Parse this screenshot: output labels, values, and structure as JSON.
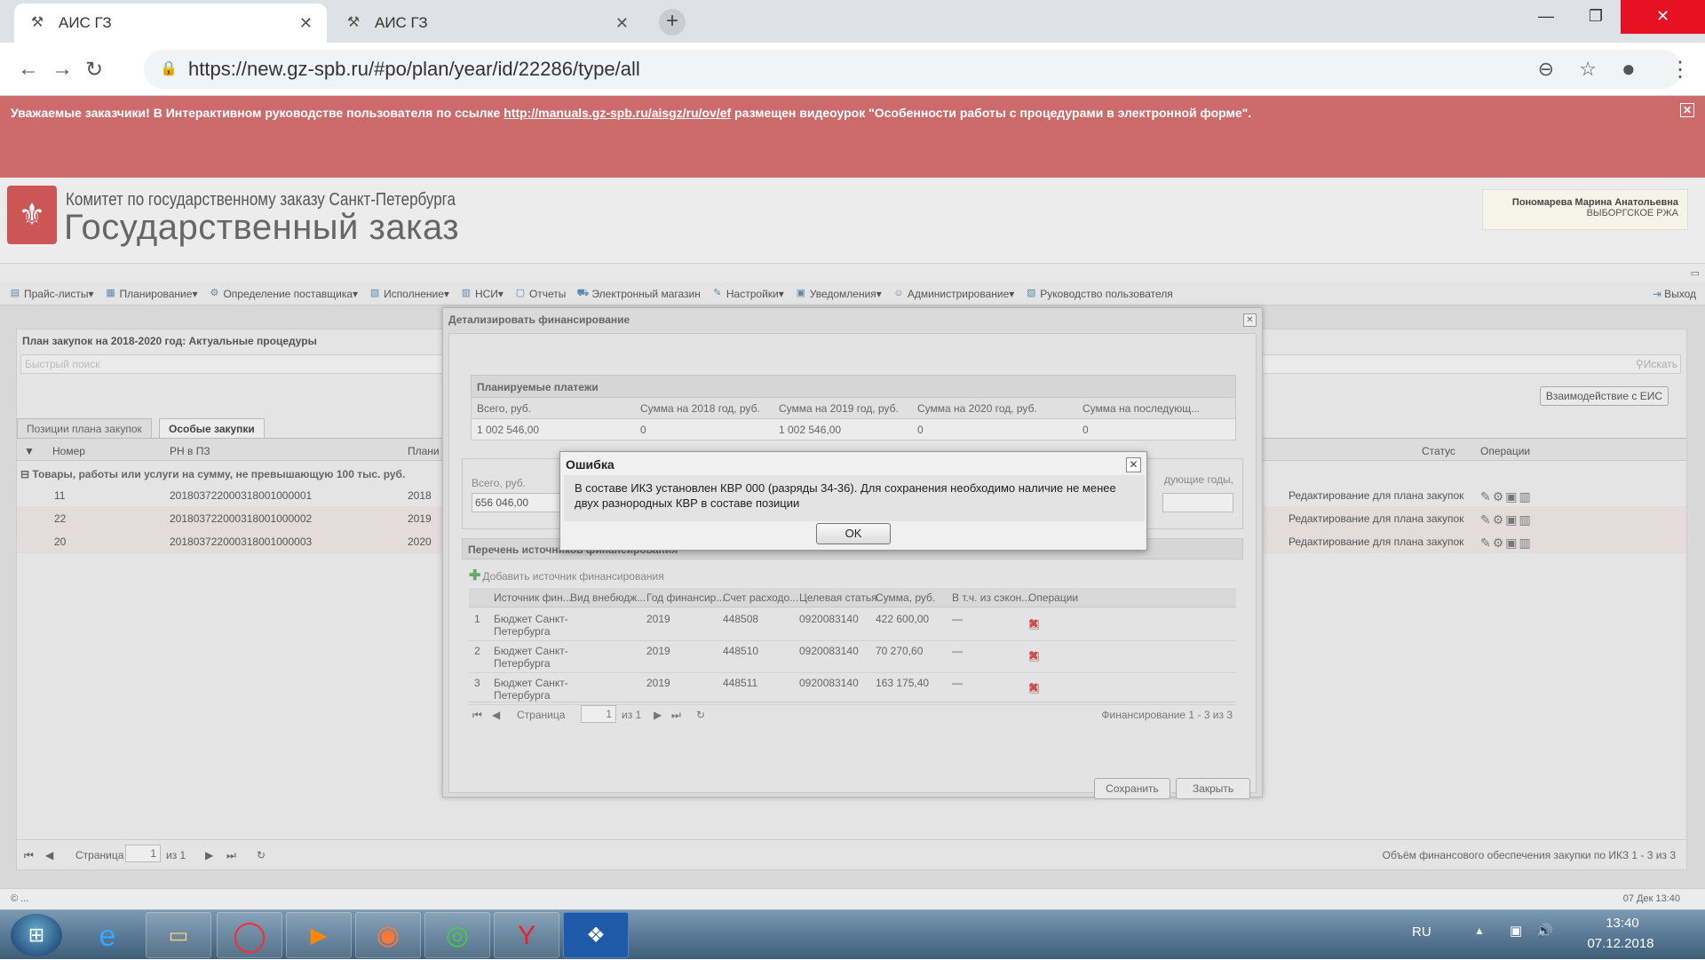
{
  "browser": {
    "tabs": [
      {
        "title": "АИС ГЗ",
        "icon": "pickaxe-icon",
        "active": true
      },
      {
        "title": "АИС ГЗ",
        "icon": "pickaxe-icon",
        "active": false
      }
    ],
    "url": "https://new.gz-spb.ru/#po/plan/year/id/22286/type/all"
  },
  "banner": {
    "text_before": "Уважаемые заказчики! В Интерактивном руководстве пользователя по ссылке ",
    "link": "http://manuals.gz-spb.ru/aisgz/ru/ov/ef",
    "text_after": " размещен видеоурок \"Особенности работы с процедурами в электронной форме\"."
  },
  "header": {
    "org_line1": "Комитет по государственному заказу Санкт-Петербурга",
    "org_line2": "Государственный заказ",
    "user_name": "Пономарева Марина Анатольевна",
    "user_org": "ВЫБОРГСКОЕ РЖА"
  },
  "menu": {
    "items": [
      {
        "label": "Прайс-листы",
        "dropdown": true
      },
      {
        "label": "Планирование",
        "dropdown": true
      },
      {
        "label": "Определение поставщика",
        "dropdown": true
      },
      {
        "label": "Исполнение",
        "dropdown": true
      },
      {
        "label": "НСИ",
        "dropdown": true
      },
      {
        "label": "Отчеты",
        "dropdown": false
      },
      {
        "label": "Электронный магазин",
        "dropdown": false
      },
      {
        "label": "Настройки",
        "dropdown": true
      },
      {
        "label": "Уведомления",
        "dropdown": true
      },
      {
        "label": "Администрирование",
        "dropdown": true
      },
      {
        "label": "Руководство пользователя",
        "dropdown": false
      }
    ],
    "exit_label": "Выход"
  },
  "panel": {
    "title": "План закупок на 2018-2020 год: Актуальные процедуры",
    "search_placeholder": "Быстрый поиск",
    "search_button": "Искать",
    "eis_button": "Взаимодействие с ЕИС",
    "tabs": [
      "Позиции плана закупок",
      "Особые закупки"
    ],
    "columns": {
      "number": "Номер",
      "rn": "РН в ПЗ",
      "plan": "Плани",
      "status": "Статус",
      "ops": "Операции"
    },
    "group_label": "Товары, работы или услуги на сумму, не превышающую 100 тыс. руб.",
    "rows": [
      {
        "number": "11",
        "rn": "201803722000318001000001",
        "year": "2018",
        "status": "Редактирование для плана закупок"
      },
      {
        "number": "22",
        "rn": "201803722000318001000002",
        "year": "2019",
        "status": "Редактирование для плана закупок"
      },
      {
        "number": "20",
        "rn": "201803722000318001000003",
        "year": "2020",
        "status": "Редактирование для плана закупок"
      }
    ],
    "pager": {
      "page_label": "Страница",
      "page": "1",
      "of": "из 1"
    },
    "footer_info": "Объём финансового обеспечения закупки по ИКЗ 1 - 3 из 3"
  },
  "status": {
    "left": "© ...",
    "right": "07 Дек 13:40"
  },
  "detail": {
    "title": "Детализировать финансирование",
    "payments": {
      "header": "Планируемые платежи",
      "columns": [
        "Всего, руб.",
        "Сумма на 2018 год, руб.",
        "Сумма на 2019 год, руб.",
        "Сумма на 2020 год, руб.",
        "Сумма на последующ..."
      ],
      "values": [
        "1 002 546,00",
        "0",
        "1 002 546,00",
        "0",
        "0"
      ]
    },
    "total_label": "Всего, руб.",
    "total_value": "656 046,00",
    "subsequent_label": "дующие годы,",
    "sources": {
      "header": "Перечень источников финансирования",
      "add_label": "Добавить источник финансирования",
      "columns": [
        "Источник фин...",
        "Вид внебюдж...",
        "Год финансир...",
        "Счет расходо...",
        "Целевая статья",
        "Сумма, руб.",
        "В т.ч. из сэкон...",
        "Операции"
      ],
      "rows": [
        {
          "n": "1",
          "source": "Бюджет Санкт-Петербурга",
          "year": "2019",
          "account": "448508",
          "article": "0920083140",
          "sum": "422 600,00",
          "saved": "—"
        },
        {
          "n": "2",
          "source": "Бюджет Санкт-Петербурга",
          "year": "2019",
          "account": "448510",
          "article": "0920083140",
          "sum": "70 270,60",
          "saved": "—"
        },
        {
          "n": "3",
          "source": "Бюджет Санкт-Петербурга",
          "year": "2019",
          "account": "448511",
          "article": "0920083140",
          "sum": "163 175,40",
          "saved": "—"
        }
      ],
      "pager_label": "Страница",
      "page": "1",
      "of": "из 1",
      "info": "Финансирование 1 - 3 из 3"
    },
    "save": "Сохранить",
    "close": "Закрыть"
  },
  "error": {
    "title": "Ошибка",
    "message": "В составе ИКЗ установлен КВР 000 (разряды 34-36). Для сохранения необходимо наличие не менее двух разнородных КВР в составе позиции",
    "ok": "OK"
  },
  "taskbar": {
    "lang": "RU",
    "time": "13:40",
    "date": "07.12.2018"
  },
  "colors": {
    "banner": "#cd6a6a",
    "close": "#e81123"
  }
}
